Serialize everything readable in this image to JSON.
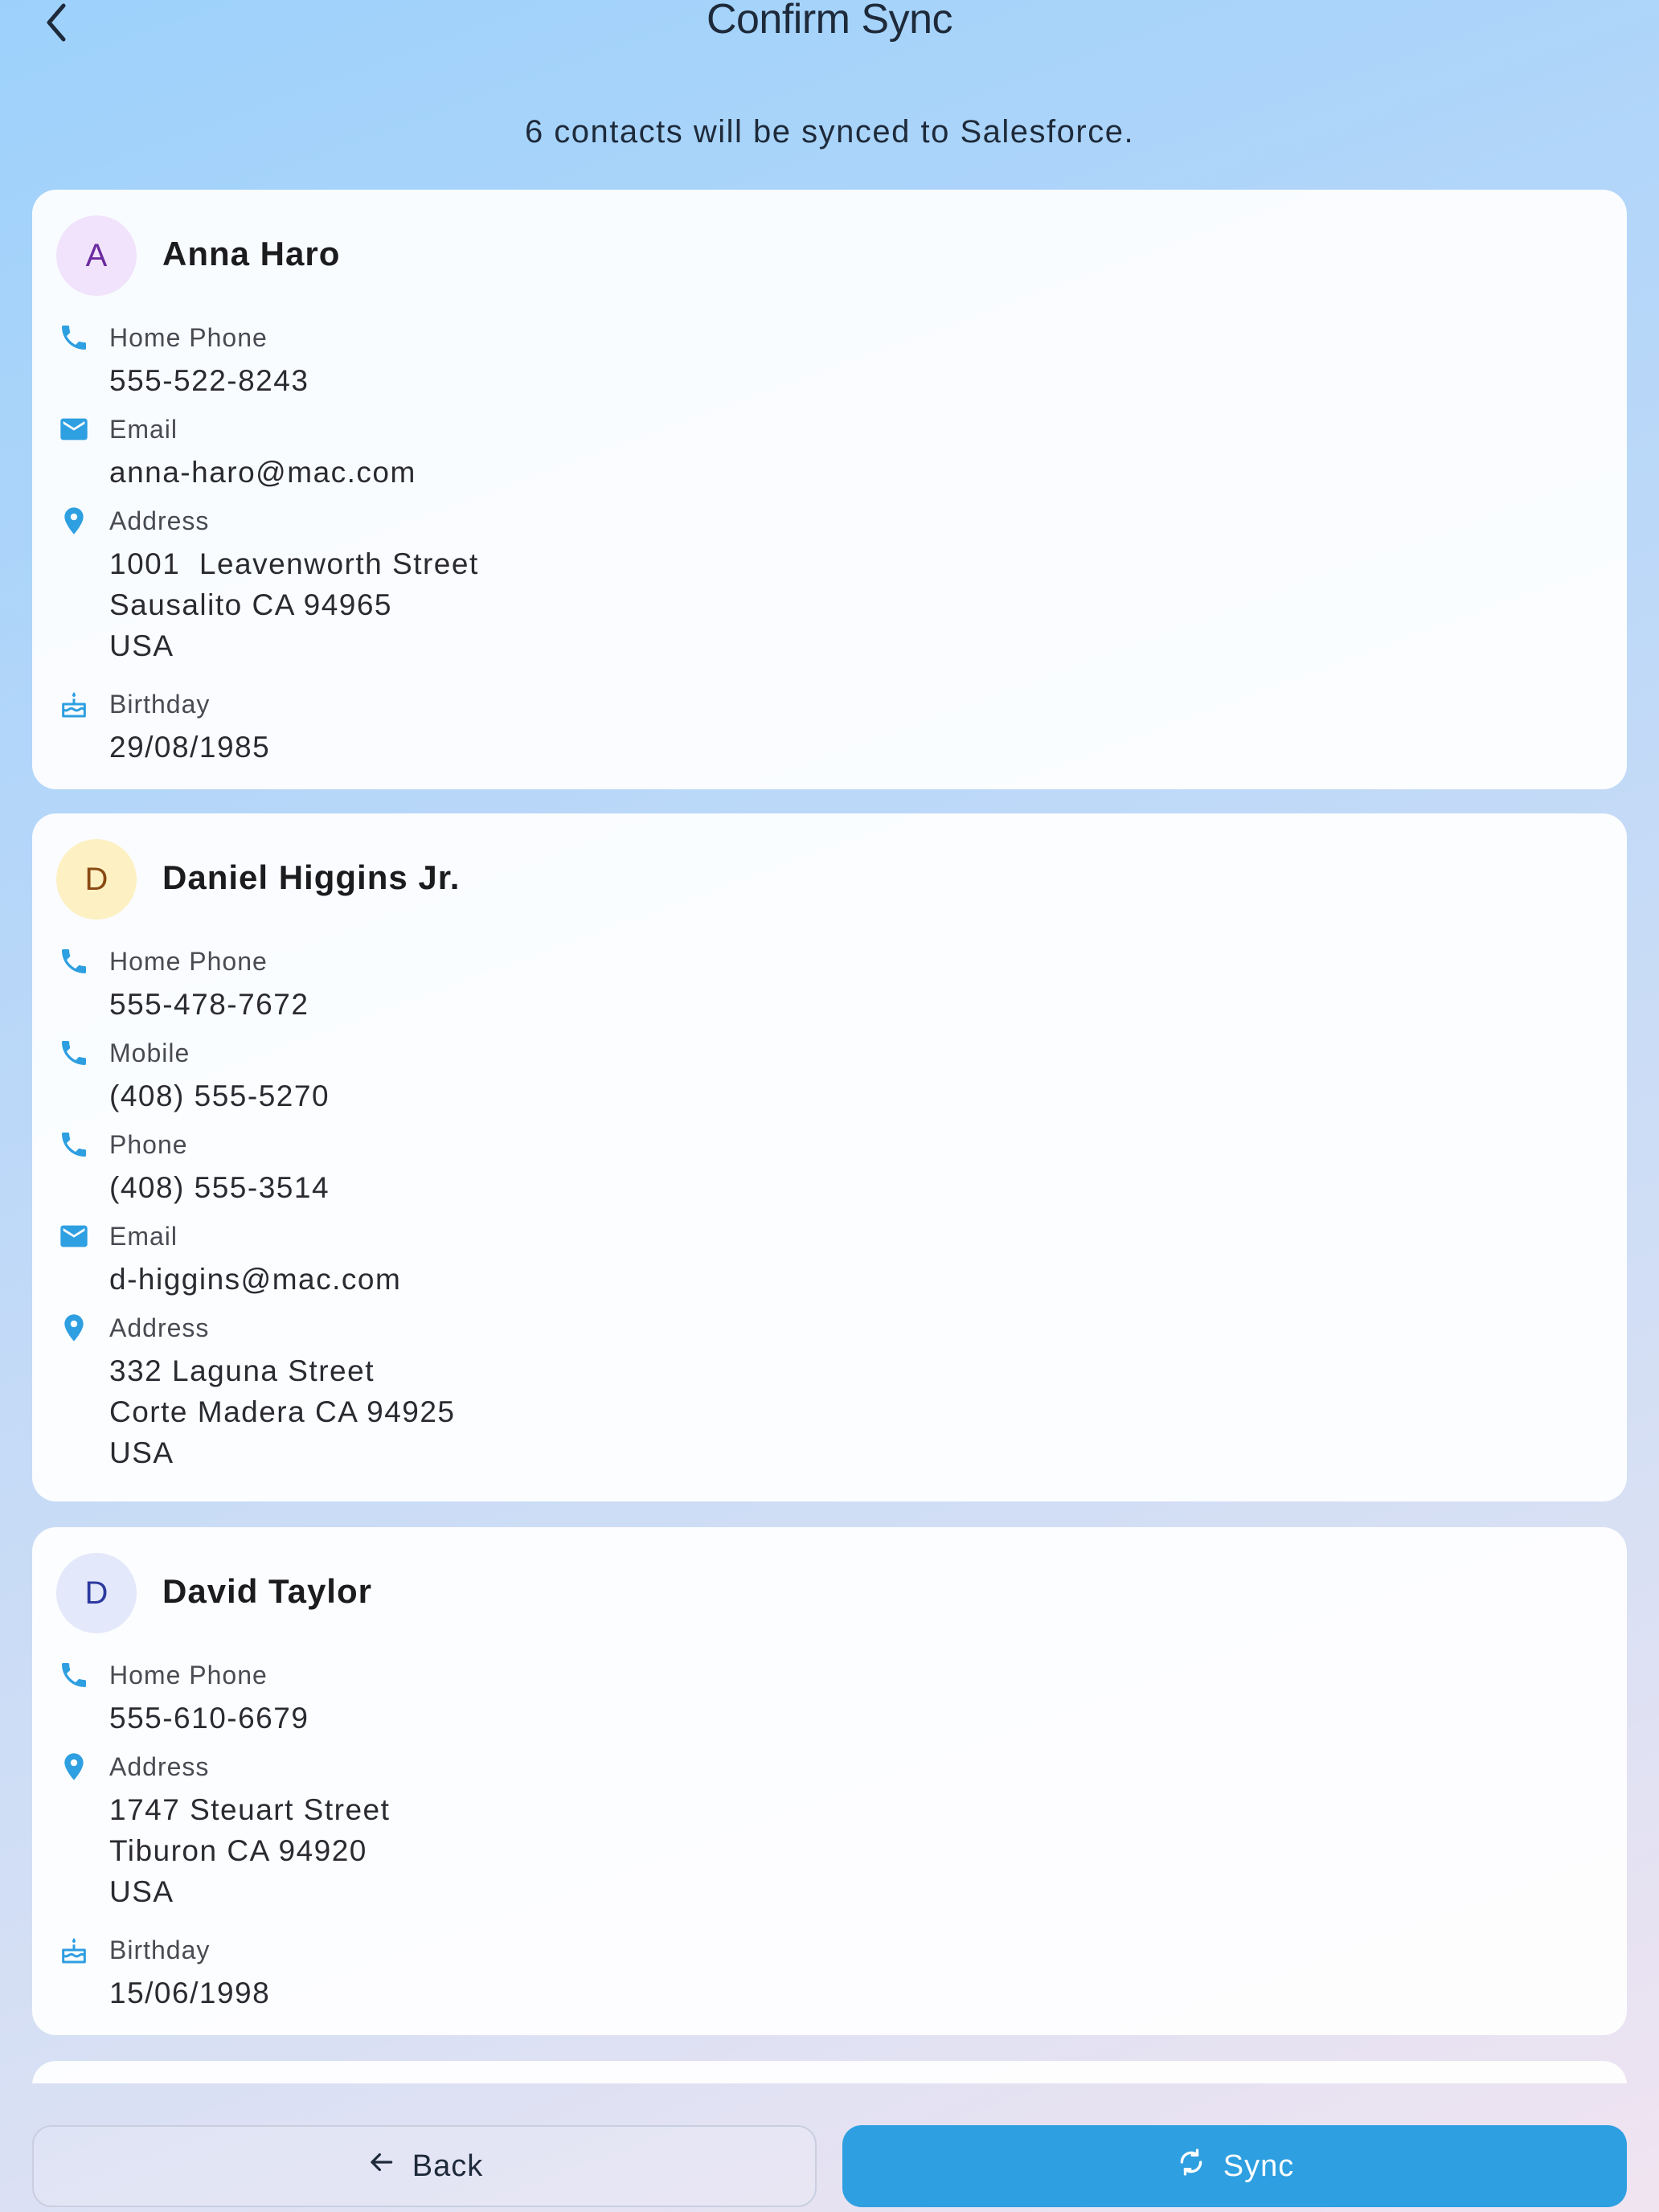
{
  "header": {
    "title": "Confirm Sync"
  },
  "summary": "6 contacts will be synced to Salesforce.",
  "contacts": [
    {
      "initial": "A",
      "name": "Anna Haro",
      "avatar_bg": "#f1e3fb",
      "avatar_fg": "#6b2aa0",
      "fields": [
        {
          "icon": "phone-icon",
          "label": "Home Phone",
          "value": "555-522-8243"
        },
        {
          "icon": "email-icon",
          "label": "Email",
          "value": "anna-haro@mac.com"
        },
        {
          "icon": "location-pin-icon",
          "label": "Address",
          "value": "1001  Leavenworth Street\nSausalito CA 94965\nUSA"
        },
        {
          "icon": "birthday-cake-icon",
          "label": "Birthday",
          "value": "29/08/1985"
        }
      ]
    },
    {
      "initial": "D",
      "name": "Daniel Higgins Jr.",
      "avatar_bg": "#fdf0c2",
      "avatar_fg": "#8a4a12",
      "fields": [
        {
          "icon": "phone-icon",
          "label": "Home Phone",
          "value": "555-478-7672"
        },
        {
          "icon": "phone-icon",
          "label": "Mobile",
          "value": "(408) 555-5270"
        },
        {
          "icon": "phone-icon",
          "label": "Phone",
          "value": "(408) 555-3514"
        },
        {
          "icon": "email-icon",
          "label": "Email",
          "value": "d-higgins@mac.com"
        },
        {
          "icon": "location-pin-icon",
          "label": "Address",
          "value": "332 Laguna Street\nCorte Madera CA 94925\nUSA"
        }
      ]
    },
    {
      "initial": "D",
      "name": "David Taylor",
      "avatar_bg": "#e3e8fb",
      "avatar_fg": "#2c3aa0",
      "fields": [
        {
          "icon": "phone-icon",
          "label": "Home Phone",
          "value": "555-610-6679"
        },
        {
          "icon": "location-pin-icon",
          "label": "Address",
          "value": "1747 Steuart Street\nTiburon CA 94920\nUSA"
        },
        {
          "icon": "birthday-cake-icon",
          "label": "Birthday",
          "value": "15/06/1998"
        }
      ]
    }
  ],
  "footer": {
    "back_label": "Back",
    "sync_label": "Sync"
  },
  "colors": {
    "accent": "#2e9fe0",
    "icon": "#2e9fe0"
  }
}
